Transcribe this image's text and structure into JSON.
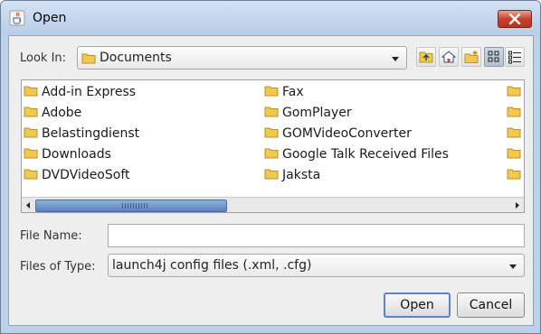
{
  "window": {
    "title": "Open"
  },
  "look_in": {
    "label": "Look In:",
    "value": "Documents"
  },
  "toolbar": {
    "buttons": [
      "up-one-level",
      "home",
      "create-new-folder",
      "list-view",
      "details-view"
    ],
    "selected": "list-view"
  },
  "files": {
    "column1": [
      "Add-in Express",
      "Adobe",
      "Belastingdienst",
      "Downloads",
      "DVDVideoSoft"
    ],
    "column2": [
      "Fax",
      "GomPlayer",
      "GOMVideoConverter",
      "Google Talk Received Files",
      "Jaksta"
    ],
    "scroll_fraction_visible": 0.4
  },
  "file_name": {
    "label": "File Name:",
    "value": ""
  },
  "files_of_type": {
    "label": "Files of Type:",
    "value": "launch4j config files (.xml, .cfg)"
  },
  "buttons": {
    "open": "Open",
    "cancel": "Cancel"
  },
  "colors": {
    "folder": "#f2c94c",
    "accent": "#5a86c4",
    "close": "#c7412d"
  }
}
